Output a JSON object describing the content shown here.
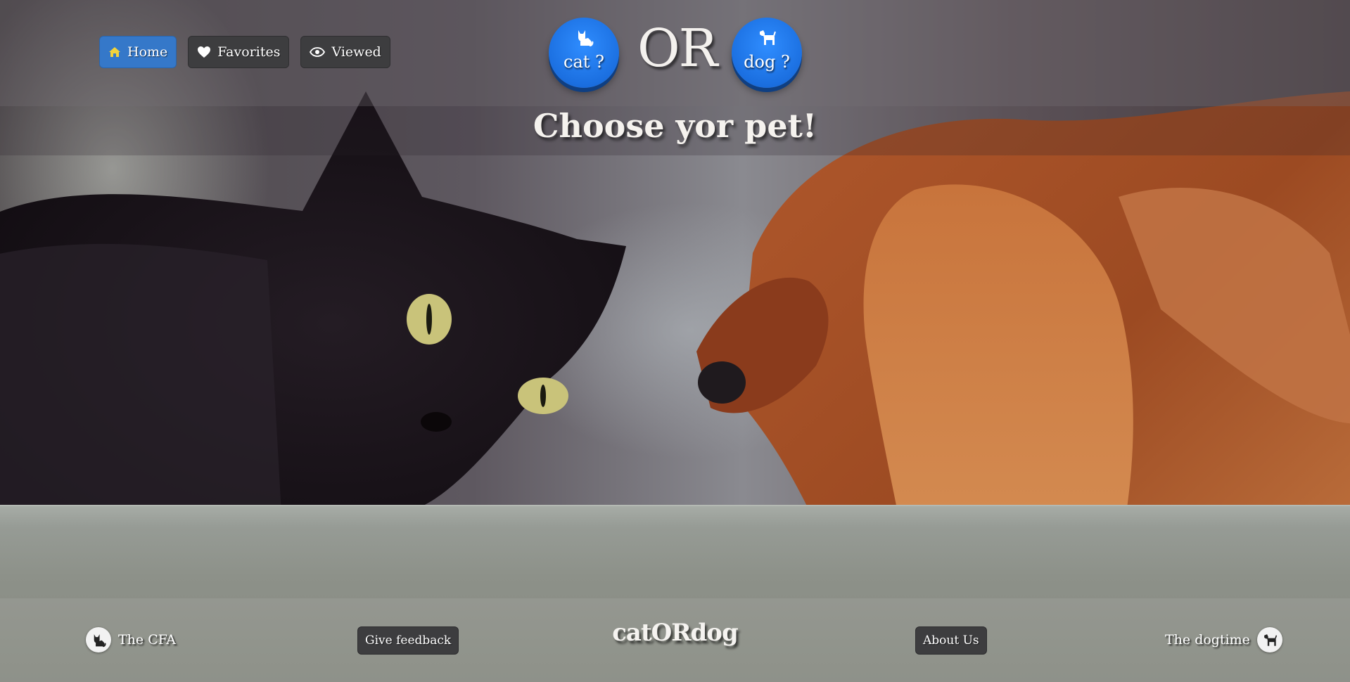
{
  "nav": {
    "items": [
      {
        "label": "Home",
        "icon": "home-icon",
        "active": true
      },
      {
        "label": "Favorites",
        "icon": "heart-icon",
        "active": false
      },
      {
        "label": "Viewed",
        "icon": "eye-icon",
        "active": false
      }
    ]
  },
  "choices": {
    "cat_label": "cat ?",
    "or_text": "OR",
    "dog_label": "dog ?"
  },
  "page_title": "Choose yor pet!",
  "footer": {
    "cfa_link": "The CFA",
    "feedback_button": "Give feedback",
    "brand": "catORdog",
    "about_button": "About Us",
    "dogtime_link": "The dogtime"
  },
  "colors": {
    "accent_blue": "#1b6fe0",
    "active_nav": "#3578c9",
    "dark_button": "#3d3d3f",
    "home_icon": "#f2d33a"
  }
}
